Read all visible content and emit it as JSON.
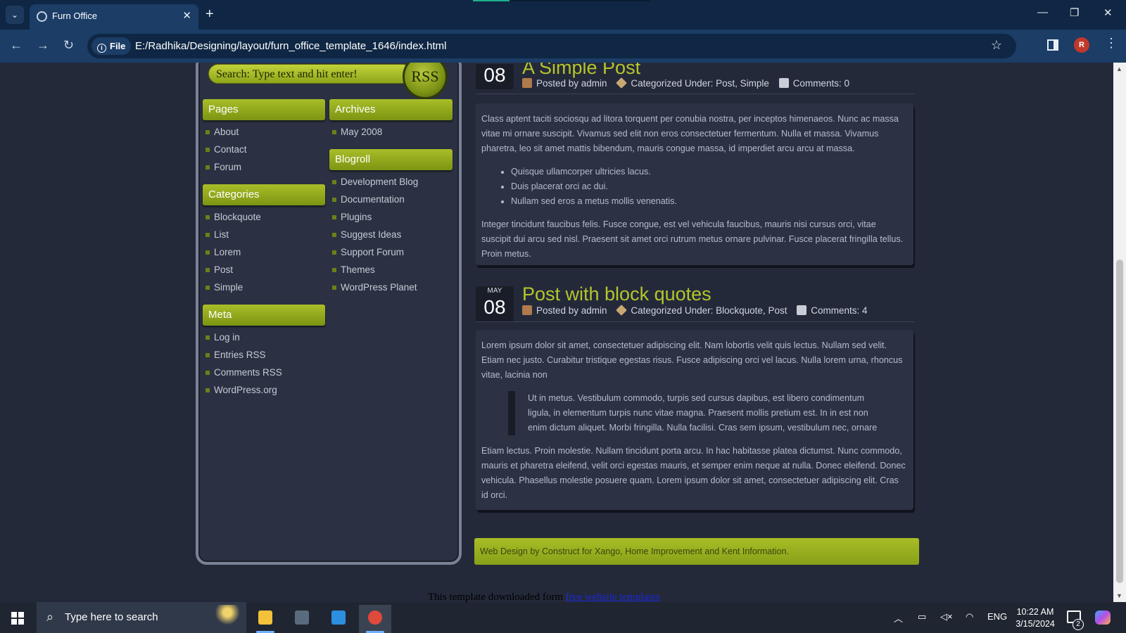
{
  "browser": {
    "tab_title": "Furn Office",
    "tab_close": "✕",
    "new_tab": "+",
    "tab_list": "⌄",
    "security_chip": "File",
    "url": "E:/Radhika/Designing/layout/furn_office_template_1646/index.html",
    "profile_initial": "R",
    "window_controls": {
      "minimize": "—",
      "restore": "❐",
      "close": "✕"
    },
    "nav": {
      "back": "←",
      "forward": "→",
      "reload": "↻"
    },
    "bookmark_star": "☆",
    "menu": "⋮"
  },
  "sidebar": {
    "search_placeholder": "Search: Type text and hit enter!",
    "rss_label": "RSS",
    "pages": {
      "title": "Pages",
      "items": [
        "About",
        "Contact",
        "Forum"
      ]
    },
    "categories": {
      "title": "Categories",
      "items": [
        "Blockquote",
        "List",
        "Lorem",
        "Post",
        "Simple"
      ]
    },
    "meta": {
      "title": "Meta",
      "items": [
        "Log in",
        "Entries RSS",
        "Comments RSS",
        "WordPress.org"
      ]
    },
    "archives": {
      "title": "Archives",
      "items": [
        "May 2008"
      ]
    },
    "blogroll": {
      "title": "Blogroll",
      "items": [
        "Development Blog",
        "Documentation",
        "Plugins",
        "Suggest Ideas",
        "Support Forum",
        "Themes",
        "WordPress Planet"
      ]
    }
  },
  "posts": [
    {
      "day": "08",
      "title": "A Simple Post",
      "posted_by": "Posted by admin",
      "categorized": "Categorized Under: Post, Simple",
      "comments": "Comments: 0",
      "p1": "Class aptent taciti sociosqu ad litora torquent per conubia nostra, per inceptos himenaeos. Nunc ac massa vitae mi ornare suscipit. Vivamus sed elit non eros consectetuer fermentum. Nulla et massa. Vivamus pharetra, leo sit amet mattis bibendum, mauris congue massa, id imperdiet arcu arcu at massa.",
      "bullets": [
        "Quisque ullamcorper ultricies lacus.",
        "Duis placerat orci ac dui.",
        "Nullam sed eros a metus mollis venenatis."
      ],
      "p2": "Integer tincidunt faucibus felis. Fusce congue, est vel vehicula faucibus, mauris nisi cursus orci, vitae suscipit dui arcu sed nisl. Praesent sit amet orci rutrum metus ornare pulvinar. Fusce placerat fringilla tellus. Proin metus."
    },
    {
      "month": "MAY",
      "day": "08",
      "title": "Post with block quotes",
      "posted_by": "Posted by admin",
      "categorized": "Categorized Under: Blockquote, Post",
      "comments": "Comments: 4",
      "p1": "Lorem ipsum dolor sit amet, consectetuer adipiscing elit. Nam lobortis velit quis lectus. Nullam sed velit. Etiam nec justo. Curabitur tristique egestas risus. Fusce adipiscing orci vel lacus. Nulla lorem urna, rhoncus vitae, lacinia non",
      "quote": "Ut in metus. Vestibulum commodo, turpis sed cursus dapibus, est libero condimentum ligula, in elementum turpis nunc vitae magna. Praesent mollis pretium est. In in est non enim dictum aliquet. Morbi fringilla. Nulla facilisi. Cras sem ipsum, vestibulum nec, ornare",
      "p2": "Etiam lectus. Proin molestie. Nullam tincidunt porta arcu. In hac habitasse platea dictumst. Nunc commodo, mauris et pharetra eleifend, velit orci egestas mauris, et semper enim neque at nulla. Donec eleifend. Donec vehicula. Phasellus molestie posuere quam. Lorem ipsum dolor sit amet, consectetuer adipiscing elit. Cras id orci."
    }
  ],
  "footer": {
    "credit": "Web Design by Construct for Xango, Home Improvement and Kent Information.",
    "template_note": "This template downloaded form",
    "template_link": "free website templates"
  },
  "taskbar": {
    "search_placeholder": "Type here to search",
    "language": "ENG",
    "time": "10:22 AM",
    "date": "3/15/2024",
    "notification_count": "2",
    "apps": [
      "file-explorer",
      "calculator",
      "vscode",
      "chrome"
    ]
  }
}
